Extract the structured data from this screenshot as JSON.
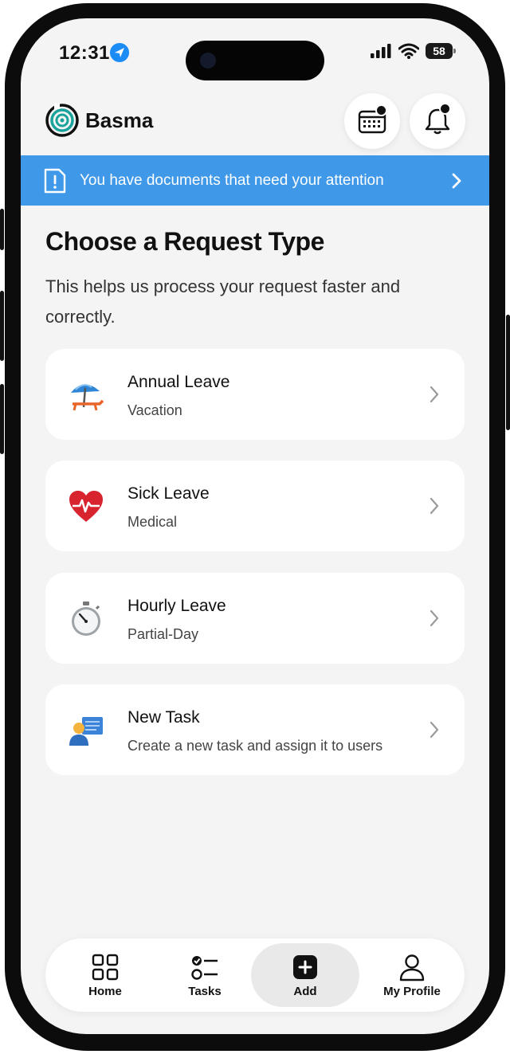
{
  "status_bar": {
    "time": "12:31",
    "battery": "58"
  },
  "header": {
    "brand": "Basma"
  },
  "banner": {
    "text": "You have documents that need your attention"
  },
  "page": {
    "title": "Choose a Request Type",
    "subtitle": "This helps us process your request faster and correctly."
  },
  "requests": [
    {
      "title": "Annual Leave",
      "subtitle": "Vacation",
      "icon": "beach-umbrella-icon"
    },
    {
      "title": "Sick Leave",
      "subtitle": "Medical",
      "icon": "heartbeat-icon"
    },
    {
      "title": "Hourly Leave",
      "subtitle": "Partial-Day",
      "icon": "stopwatch-icon"
    },
    {
      "title": "New Task",
      "subtitle": "Create a new task and assign it to users",
      "icon": "presenter-icon"
    }
  ],
  "tabs": [
    {
      "label": "Home",
      "icon": "grid-icon"
    },
    {
      "label": "Tasks",
      "icon": "checklist-icon"
    },
    {
      "label": "Add",
      "icon": "plus-square-icon",
      "active": true
    },
    {
      "label": "My Profile",
      "icon": "user-icon"
    }
  ],
  "colors": {
    "banner": "#3f98e8",
    "background": "#f4f4f5",
    "card": "#ffffff",
    "brand_ring": "#1aa39a"
  }
}
